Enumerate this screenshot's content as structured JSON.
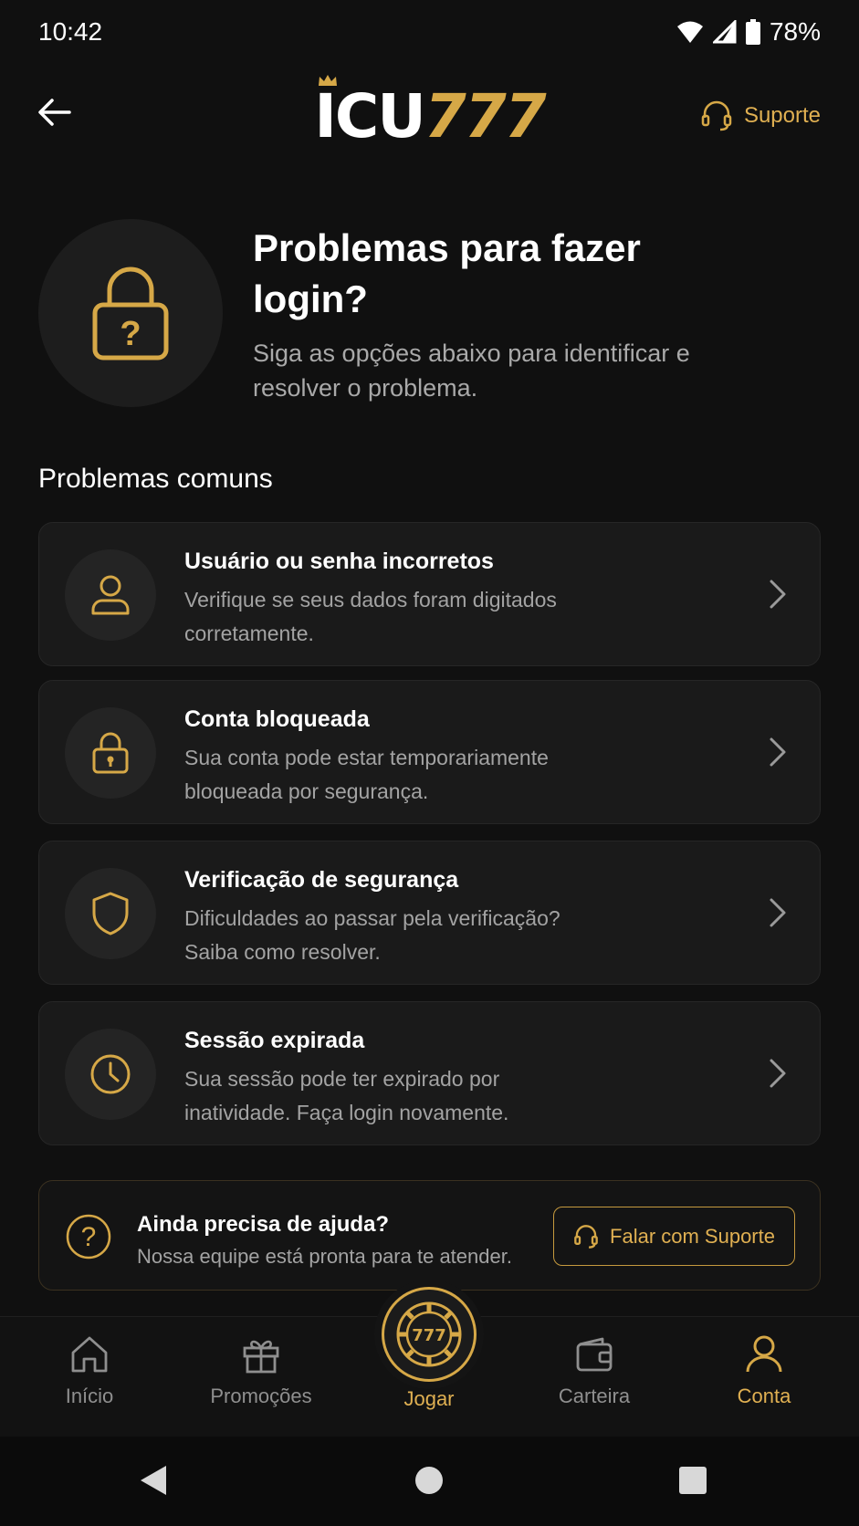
{
  "status_bar": {
    "time": "10:42",
    "battery": "78%"
  },
  "header": {
    "logo_white": "ICU",
    "logo_gold": "777",
    "support_label": "Suporte"
  },
  "hero": {
    "title": "Problemas para fazer login?",
    "subtitle": "Siga as opções abaixo para identificar e resolver o problema."
  },
  "section_title": "Problemas comuns",
  "problems": [
    {
      "icon": "user-icon",
      "title": "Usuário ou senha incorretos",
      "description": "Verifique se seus dados foram digitados corretamente."
    },
    {
      "icon": "lock-icon",
      "title": "Conta bloqueada",
      "description": "Sua conta pode estar temporariamente bloqueada por segurança."
    },
    {
      "icon": "shield-icon",
      "title": "Verificação de segurança",
      "description": "Dificuldades ao passar pela verificação? Saiba como resolver."
    },
    {
      "icon": "clock-icon",
      "title": "Sessão expirada",
      "description": "Sua sessão pode ter expirado por inatividade. Faça login novamente."
    }
  ],
  "help": {
    "title": "Ainda precisa de ajuda?",
    "description": "Nossa equipe está pronta para te atender.",
    "button_label": "Falar com Suporte"
  },
  "nav": {
    "home": "Início",
    "promotions": "Promoções",
    "play": "Jogar",
    "play_chip_text": "777",
    "wallet": "Carteira",
    "account": "Conta",
    "active": "account"
  },
  "colors": {
    "background": "#101010",
    "accent_gold": "#d6a847",
    "card_bg": "#1a1a1a",
    "text_muted": "#a3a3a3"
  }
}
